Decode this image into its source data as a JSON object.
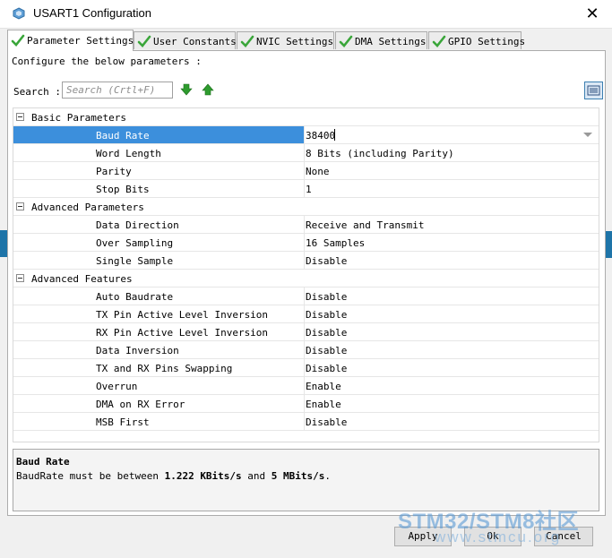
{
  "window": {
    "title": "USART1 Configuration",
    "close_glyph": "✕"
  },
  "tabs": [
    {
      "label": "Parameter Settings",
      "active": true
    },
    {
      "label": "User Constants",
      "active": false
    },
    {
      "label": "NVIC Settings",
      "active": false
    },
    {
      "label": "DMA Settings",
      "active": false
    },
    {
      "label": "GPIO Settings",
      "active": false
    }
  ],
  "panel": {
    "configure_text": "Configure the below parameters :",
    "search_label": "Search :",
    "search_placeholder": "Search (Crtl+F)"
  },
  "groups": [
    {
      "name": "Basic Parameters",
      "params": [
        {
          "name": "Baud Rate",
          "value": "38400"
        },
        {
          "name": "Word Length",
          "value": "8 Bits (including Parity)"
        },
        {
          "name": "Parity",
          "value": "None"
        },
        {
          "name": "Stop Bits",
          "value": "1"
        }
      ]
    },
    {
      "name": "Advanced Parameters",
      "params": [
        {
          "name": "Data Direction",
          "value": "Receive and Transmit"
        },
        {
          "name": "Over Sampling",
          "value": "16 Samples"
        },
        {
          "name": "Single Sample",
          "value": "Disable"
        }
      ]
    },
    {
      "name": "Advanced Features",
      "params": [
        {
          "name": "Auto Baudrate",
          "value": "Disable"
        },
        {
          "name": "TX Pin Active Level Inversion",
          "value": "Disable"
        },
        {
          "name": "RX Pin Active Level Inversion",
          "value": "Disable"
        },
        {
          "name": "Data Inversion",
          "value": "Disable"
        },
        {
          "name": "TX and RX Pins Swapping",
          "value": "Disable"
        },
        {
          "name": "Overrun",
          "value": "Enable"
        },
        {
          "name": "DMA on RX Error",
          "value": "Enable"
        },
        {
          "name": "MSB First",
          "value": "Disable"
        }
      ]
    }
  ],
  "description": {
    "title": "Baud Rate",
    "text_pre": "BaudRate must be between ",
    "min": "1.222 KBits/s",
    "text_mid": " and ",
    "max": "5 MBits/s",
    "text_post": "."
  },
  "buttons": {
    "apply": "Apply",
    "ok": "Ok",
    "cancel": "Cancel"
  },
  "watermark": {
    "line1": "STM32/STM8社区",
    "line2": "www.stmcu.org"
  },
  "colors": {
    "selection": "#3c8fdc",
    "check_green": "#3aa63a",
    "arrow_green": "#2e9b2e"
  }
}
